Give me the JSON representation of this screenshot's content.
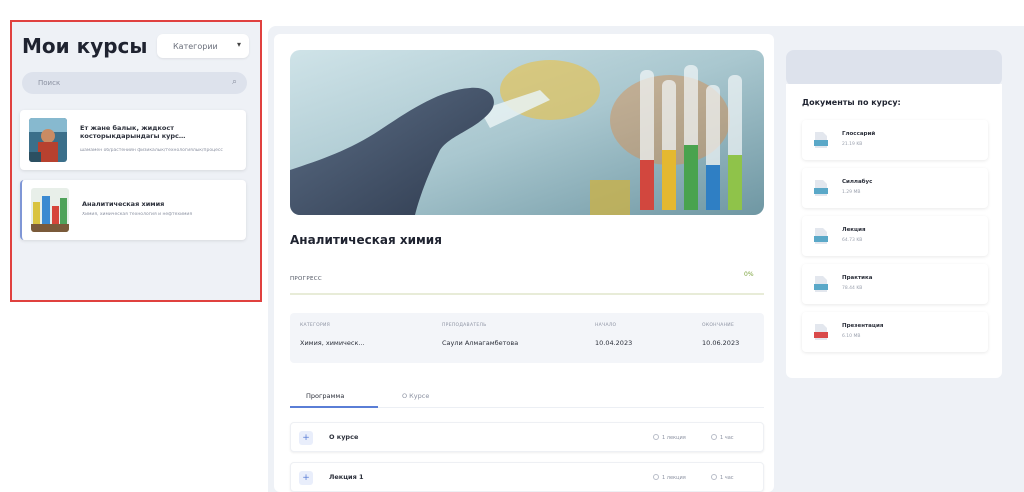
{
  "sidebar": {
    "title": "Мои курсы",
    "category_select": "Категории",
    "search_placeholder": "Поиск",
    "courses": [
      {
        "title": "Ет жане балык, жидкост косторыкдарындагы курс…",
        "subtitle": "шамамен об/растенийн физикалык/технологиялык/процесс"
      },
      {
        "title": "Аналитическая химия",
        "subtitle": "Химия, химическая технология и нефтехимия"
      }
    ]
  },
  "course": {
    "title": "Аналитическая химия",
    "progress_label": "ПРОГРЕСС",
    "progress_value": "0%",
    "progress_fraction": 0.0,
    "info": {
      "category_label": "КАТЕГОРИЯ",
      "category_value": "Химия, химическ...",
      "teacher_label": "ПРЕПОДАВАТЕЛЬ",
      "teacher_value": "Саули Алмагамбетова",
      "start_label": "НАЧАЛО",
      "start_value": "10.04.2023",
      "end_label": "ОКОНЧАНИЕ",
      "end_value": "10.06.2023"
    },
    "tabs": [
      "Программа",
      "О Курсе"
    ],
    "modules": [
      {
        "title": "О курсе",
        "lectures": "1 лекция",
        "duration": "1 час"
      },
      {
        "title": "Лекция 1",
        "lectures": "1 лекция",
        "duration": "1 час"
      }
    ]
  },
  "documents": {
    "title": "Документы по курсу:",
    "items": [
      {
        "name": "Глоссарий",
        "size": "21.19 KB",
        "color": "#5aa8c8"
      },
      {
        "name": "Силлабус",
        "size": "1.29 MB",
        "color": "#5aa8c8"
      },
      {
        "name": "Лекция",
        "size": "64.73 KB",
        "color": "#5aa8c8"
      },
      {
        "name": "Практика",
        "size": "78.44 KB",
        "color": "#5aa8c8"
      },
      {
        "name": "Презентация",
        "size": "6.10 MB",
        "color": "#d94a4a"
      }
    ]
  }
}
